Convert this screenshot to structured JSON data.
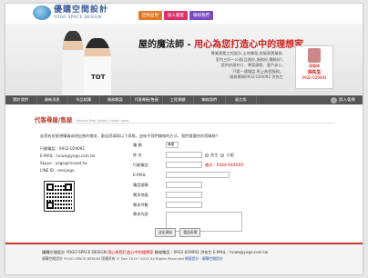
{
  "header": {
    "logo_cn": "優購空間設計",
    "logo_en": "YOGO SPACE DESIGN",
    "tabs": [
      {
        "label": "回到首頁",
        "color": "#e07a2a"
      },
      {
        "label": "加入最愛",
        "color": "#d6336c"
      },
      {
        "label": "聯絡我們",
        "color": "#7a4cc0"
      }
    ]
  },
  "banner": {
    "slogan_prefix": "屋的魔法師 - ",
    "slogan_highlight": "用心為您打造心中的理想家",
    "shirt_text": "TOT",
    "desc_lines": [
      "專業建築工程設計,土地開發,房屋買賣業務,",
      "室內三好一公道(品質好,服務好,價格好),",
      "提供房屋仲介、專案開發、客戶安心,",
      "只要一通電話,馬上為您服務。",
      "服務專線0932-029092 洪先生"
    ],
    "badge_title": "建築師",
    "badge_name": "洪先生",
    "badge_phone": "0932-029092"
  },
  "nav": {
    "items": [
      "關於我們",
      "最新消息",
      "作品相簿",
      "服務範圍",
      "代客尋屋/售屋",
      "工程實績",
      "聯絡我們",
      "留言版",
      "關於我們"
    ],
    "member_label": "加入會員"
  },
  "content": {
    "title": "代客尋屋/售屋",
    "subtitle": "Wanted Real Estate / Home sales",
    "intro": "若您有房屋想購買或想出售的需求，歡迎您填寫以下表格，並給予我們聯絡的方式，我們會儘快與您聯絡!!",
    "contact": {
      "phone": "行動電話 : 0932-029092",
      "email": "E-MAIL : hcwe@yogo.com.tw",
      "skype": "Skype : yogo@msaad.tw",
      "line": "LINE ID : me/yogo"
    }
  },
  "form": {
    "type_label": "種    類",
    "type_value": "尋屋",
    "name_label": "姓    名",
    "gender_male": "先生",
    "gender_female": "小姐",
    "mobile_label": "行動電話",
    "mobile_note": "格式 : XXXX-XXXXXX",
    "email_label": "E-MAIL",
    "phone_label": "電話號碼",
    "district_label": "需求地區",
    "budget_label": "需求坪數",
    "content_label": "需求內容",
    "submit": "送出資料",
    "reset": "重設表單"
  },
  "footer": {
    "line1_company": "優購空間設計 YOGO SPACE DESIGN",
    "line1_slogan": "用心為您打造心中的理想家",
    "line1_contact": "聯絡電話 : 0932-029092  洪先生  E-MAIL : hcwe@yogo.com.tw",
    "line2": "優購空間設計 YOGO SPACE DESIGN  版權所有 © Dec 2015~2015 All Rights Reserved",
    "line2_link": "網頁設計 : 優購空間設計"
  }
}
